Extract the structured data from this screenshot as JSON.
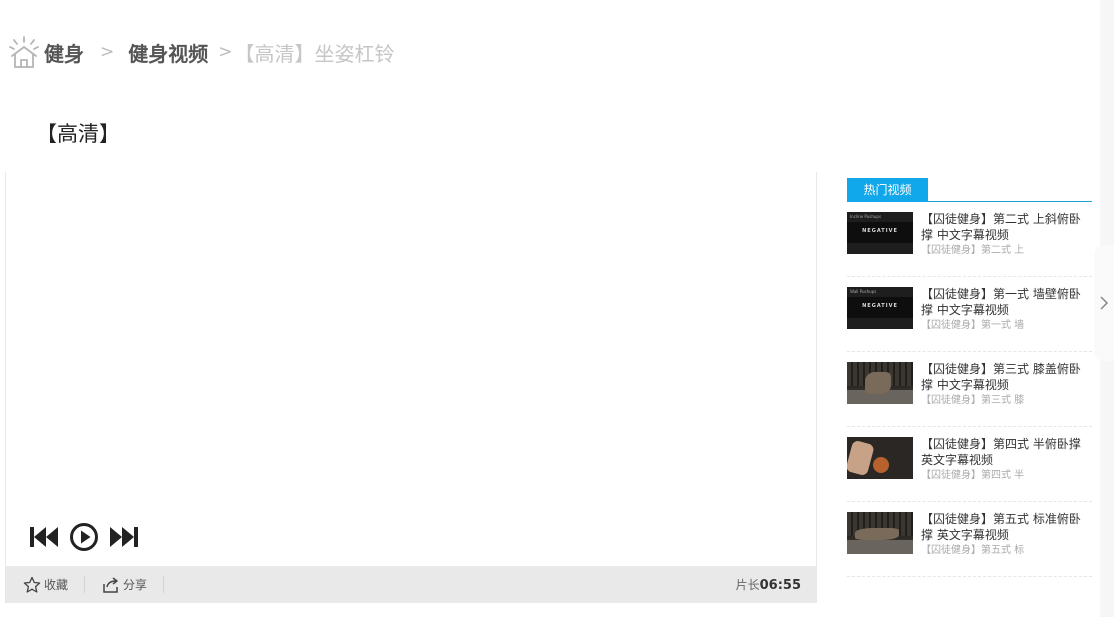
{
  "breadcrumb": {
    "home": "健身",
    "sep1": ">",
    "category": "健身视频",
    "sep2": ">",
    "current": "【高清】坐姿杠铃"
  },
  "page": {
    "title": "【高清】"
  },
  "player": {
    "controls": {
      "prev_icon": "skip-previous-icon",
      "play_icon": "play-circle-icon",
      "next_icon": "skip-next-icon"
    },
    "actions": {
      "favorite_label": "收藏",
      "share_label": "分享"
    },
    "duration_label": "片长",
    "duration_value": "06:55"
  },
  "sidebar": {
    "tab_label": "热门视频",
    "videos": [
      {
        "title": "【囚徒健身】第二式 上斜俯卧撑 中文字幕视频",
        "subtitle": "【囚徒健身】第二式 上",
        "thumb_caption": "NEGATIVE",
        "thumb_small": "Incline Pushups"
      },
      {
        "title": "【囚徒健身】第一式 墙壁俯卧撑 中文字幕视频",
        "subtitle": "【囚徒健身】第一式 墙",
        "thumb_caption": "NEGATIVE",
        "thumb_small": "Wall Pushups"
      },
      {
        "title": "【囚徒健身】第三式 膝盖俯卧撑 中文字幕视频",
        "subtitle": "【囚徒健身】第三式 膝"
      },
      {
        "title": "【囚徒健身】第四式 半俯卧撑 英文字幕视频",
        "subtitle": "【囚徒健身】第四式 半"
      },
      {
        "title": "【囚徒健身】第五式 标准俯卧撑 英文字幕视频",
        "subtitle": "【囚徒健身】第五式 标"
      }
    ]
  },
  "colors": {
    "accent": "#10a8ea",
    "action_bar": "#e9e9e9"
  }
}
